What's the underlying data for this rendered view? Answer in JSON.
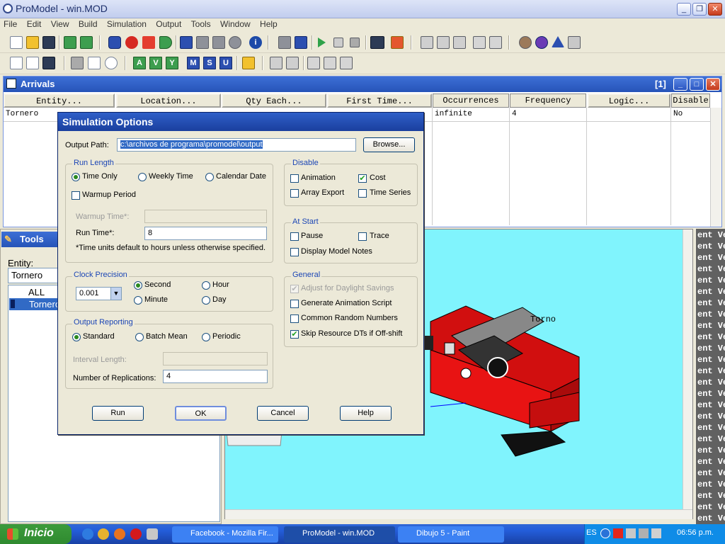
{
  "app": {
    "title": "ProModel - win.MOD"
  },
  "menu": [
    "File",
    "Edit",
    "View",
    "Build",
    "Simulation",
    "Output",
    "Tools",
    "Window",
    "Help"
  ],
  "toolbar2_letters": [
    "A",
    "V",
    "Y",
    "M",
    "S",
    "U"
  ],
  "arrivals": {
    "title": "Arrivals",
    "index": "[1]",
    "columns": [
      "Entity...",
      "Location...",
      "Qty Each...",
      "First Time...",
      "Occurrences",
      "Frequency",
      "Logic...",
      "Disable"
    ],
    "row": {
      "entity": "Tornero",
      "occurrences": "infinite",
      "frequency": "4",
      "disable": "No"
    }
  },
  "tools": {
    "title": "Tools",
    "entity_label": "Entity:",
    "entity_value": "Tornero",
    "list": [
      "ALL",
      "Tornero"
    ]
  },
  "canvas": {
    "label": "Torno"
  },
  "side_text": "ent Ve",
  "dialog": {
    "title": "Simulation Options",
    "output_path_label": "Output Path:",
    "output_path_value": "c:\\archivos de programa\\promodel\\output",
    "browse": "Browse...",
    "run_length": {
      "title": "Run Length",
      "time_only": "Time Only",
      "weekly_time": "Weekly Time",
      "calendar_date": "Calendar Date",
      "warmup_period": "Warmup Period",
      "warmup_time_label": "Warmup Time*:",
      "run_time_label": "Run Time*:",
      "run_time_value": "8",
      "note": "*Time units default to hours unless otherwise specified."
    },
    "disable": {
      "title": "Disable",
      "animation": "Animation",
      "cost": "Cost",
      "array_export": "Array Export",
      "time_series": "Time Series"
    },
    "at_start": {
      "title": "At Start",
      "pause": "Pause",
      "trace": "Trace",
      "display_notes": "Display Model Notes"
    },
    "clock": {
      "title": "Clock Precision",
      "value": "0.001",
      "second": "Second",
      "hour": "Hour",
      "minute": "Minute",
      "day": "Day"
    },
    "general": {
      "title": "General",
      "dst": "Adjust for Daylight Savings",
      "gen_anim": "Generate Animation Script",
      "crn": "Common Random Numbers",
      "skip_dt": "Skip Resource DTs if Off-shift"
    },
    "output_reporting": {
      "title": "Output Reporting",
      "standard": "Standard",
      "batch_mean": "Batch Mean",
      "periodic": "Periodic",
      "interval_label": "Interval Length:",
      "reps_label": "Number of Replications:",
      "reps_value": "4"
    },
    "buttons": {
      "run": "Run",
      "ok": "OK",
      "cancel": "Cancel",
      "help": "Help"
    }
  },
  "taskbar": {
    "start": "Inicio",
    "tasks": [
      "Facebook - Mozilla Fir...",
      "ProModel - win.MOD",
      "Dibujo 5 - Paint"
    ],
    "lang": "ES",
    "clock": "06:56 p.m."
  }
}
